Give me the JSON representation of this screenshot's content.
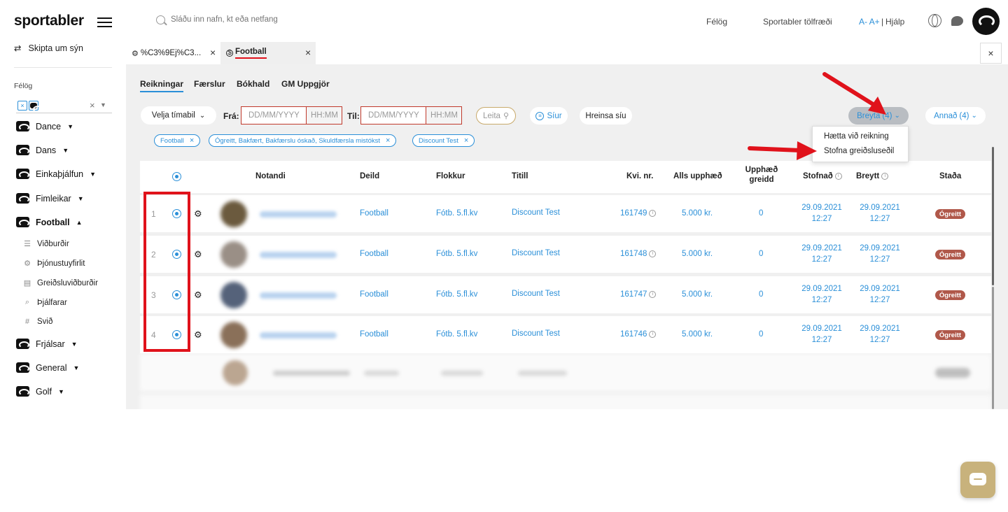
{
  "app": {
    "logo": "sportabler",
    "switch_view": "Skipta um sýn",
    "felog_label": "Félög",
    "selected_tag": "×"
  },
  "header": {
    "search_placeholder": "Sláðu inn nafn, kt eða netfang",
    "links": {
      "felog": "Félög",
      "stats": "Sportabler tölfræði",
      "font_sizes": "A- A+",
      "sep": "|",
      "help": "Hjálp"
    }
  },
  "sidebar": {
    "sports": [
      {
        "label": "Dance",
        "expanded": false
      },
      {
        "label": "Dans",
        "expanded": false
      },
      {
        "label": "Einkaþjálfun",
        "expanded": false
      },
      {
        "label": "Fimleikar",
        "expanded": false
      },
      {
        "label": "Football",
        "expanded": true
      },
      {
        "label": "Frjálsar",
        "expanded": false
      },
      {
        "label": "General",
        "expanded": false
      },
      {
        "label": "Golf",
        "expanded": false
      }
    ],
    "football_sub": [
      {
        "label": "Viðburðir",
        "icon": "list-icon"
      },
      {
        "label": "Þjónustuyfirlit",
        "icon": "gear-icon"
      },
      {
        "label": "Greiðsluviðburðir",
        "icon": "payment-icon"
      },
      {
        "label": "Þjálfarar",
        "icon": "whistle-icon"
      },
      {
        "label": "Svið",
        "icon": "hash-icon"
      }
    ]
  },
  "tabs": [
    {
      "label": "%C3%9Ej%C3...",
      "icon": "gear-icon",
      "active": false
    },
    {
      "label": "Football",
      "icon": "dollar-icon",
      "active": true
    }
  ],
  "subnav": [
    "Reikningar",
    "Færslur",
    "Bókhald",
    "GM Uppgjör"
  ],
  "filters": {
    "period": "Velja tímabil",
    "from_label": "Frá:",
    "to_label": "Til:",
    "date_placeholder": "DD/MM/YYYY",
    "time_placeholder": "HH:MM",
    "search": "Leita",
    "filters_btn": "Síur",
    "clear": "Hreinsa síu",
    "edit": "Breyta",
    "edit_count": "(4)",
    "other": "Annað",
    "other_count": "(4)"
  },
  "active_filters": [
    "Football",
    "Ógreitt, Bakfært, Bakfærslu óskað, Skuldfærsla mistókst",
    "Discount Test"
  ],
  "dropdown": {
    "items": [
      "Hætta við reikning",
      "Stofna greiðsluseðil"
    ]
  },
  "table": {
    "headers": {
      "user": "Notandi",
      "dept": "Deild",
      "category": "Flokkur",
      "title": "Titill",
      "invoice": "Kvi. nr.",
      "total": "Alls upphæð",
      "paid_1": "Upphæð",
      "paid_2": "greidd",
      "created": "Stofnað",
      "modified": "Breytt",
      "status": "Staða"
    },
    "rows": [
      {
        "num": "1",
        "dept": "Football",
        "category": "Fótb. 5.fl.kv",
        "title": "Discount Test",
        "invoice": "161749",
        "total": "5.000 kr.",
        "paid": "0",
        "created_date": "29.09.2021",
        "created_time": "12:27",
        "mod_date": "29.09.2021",
        "mod_time": "12:27",
        "status": "Ógreitt"
      },
      {
        "num": "2",
        "dept": "Football",
        "category": "Fótb. 5.fl.kv",
        "title": "Discount Test",
        "invoice": "161748",
        "total": "5.000 kr.",
        "paid": "0",
        "created_date": "29.09.2021",
        "created_time": "12:27",
        "mod_date": "29.09.2021",
        "mod_time": "12:27",
        "status": "Ógreitt"
      },
      {
        "num": "3",
        "dept": "Football",
        "category": "Fótb. 5.fl.kv",
        "title": "Discount Test",
        "invoice": "161747",
        "total": "5.000 kr.",
        "paid": "0",
        "created_date": "29.09.2021",
        "created_time": "12:27",
        "mod_date": "29.09.2021",
        "mod_time": "12:27",
        "status": "Ógreitt"
      },
      {
        "num": "4",
        "dept": "Football",
        "category": "Fótb. 5.fl.kv",
        "title": "Discount Test",
        "invoice": "161746",
        "total": "5.000 kr.",
        "paid": "0",
        "created_date": "29.09.2021",
        "created_time": "12:27",
        "mod_date": "29.09.2021",
        "mod_time": "12:27",
        "status": "Ógreitt"
      }
    ]
  },
  "colors": {
    "accent": "#2a8fd8",
    "status_unpaid": "#b0584a",
    "annotation_red": "#e0121b"
  }
}
